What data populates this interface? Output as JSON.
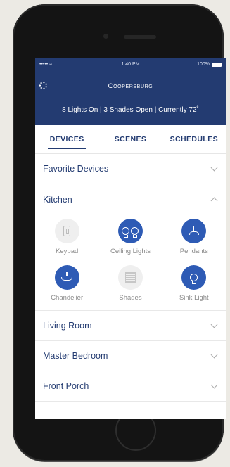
{
  "status_bar": {
    "signal": "••••• ≈",
    "time": "1:40 PM",
    "battery": "100%"
  },
  "header": {
    "home_name": "Coopersburg",
    "summary": "8 Lights On | 3 Shades Open | Currently 72˚"
  },
  "tabs": [
    {
      "label": "DEVICES",
      "active": true
    },
    {
      "label": "SCENES",
      "active": false
    },
    {
      "label": "SCHEDULES",
      "active": false
    }
  ],
  "sections": {
    "favorites": {
      "label": "Favorite Devices",
      "expanded": false
    },
    "kitchen": {
      "label": "Kitchen",
      "expanded": true,
      "devices": [
        {
          "label": "Keypad",
          "state": "off",
          "icon": "keypad-icon"
        },
        {
          "label": "Ceiling Lights",
          "state": "on",
          "icon": "ceiling-lights-icon"
        },
        {
          "label": "Pendants",
          "state": "on",
          "icon": "pendant-icon"
        },
        {
          "label": "Chandelier",
          "state": "on",
          "icon": "chandelier-icon"
        },
        {
          "label": "Shades",
          "state": "off",
          "icon": "shades-icon"
        },
        {
          "label": "Sink Light",
          "state": "on",
          "icon": "bulb-icon"
        }
      ]
    },
    "living_room": {
      "label": "Living Room",
      "expanded": false
    },
    "master_bedroom": {
      "label": "Master Bedroom",
      "expanded": false
    },
    "front_porch": {
      "label": "Front Porch",
      "expanded": false
    }
  },
  "colors": {
    "brand": "#233b71",
    "device_on": "#2e5bb5",
    "device_off": "#efefef"
  }
}
